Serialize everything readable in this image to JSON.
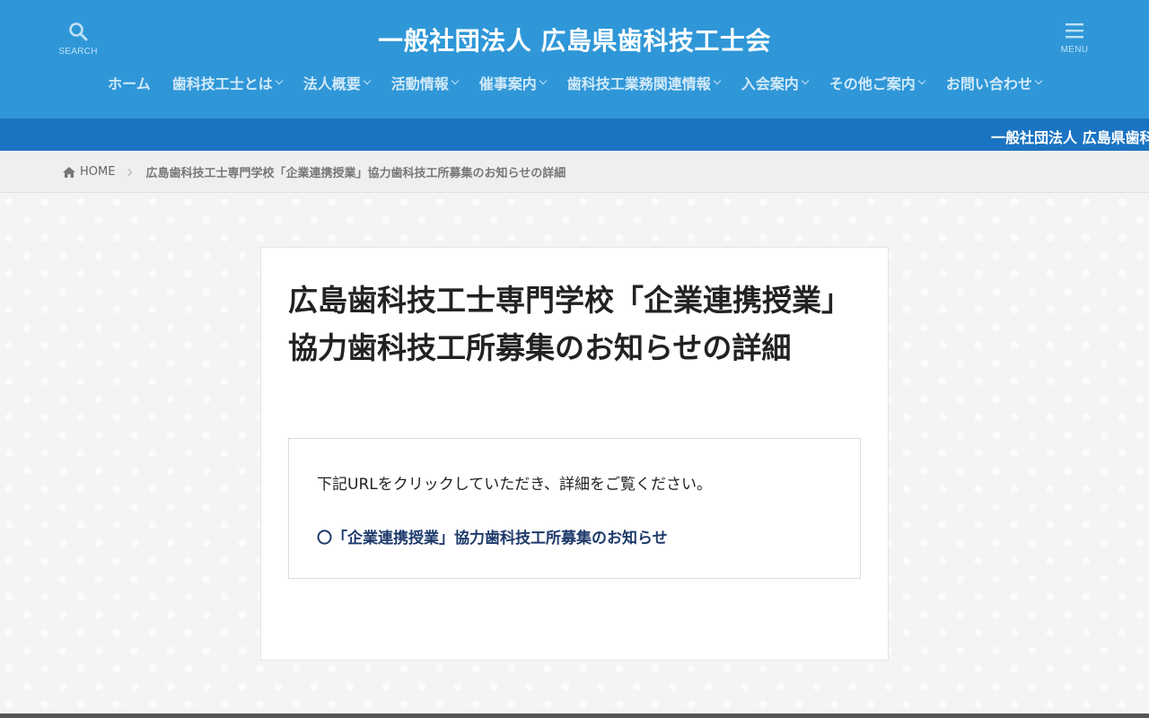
{
  "header": {
    "site_title": "一般社団法人 広島県歯科技工士会",
    "search_label": "SEARCH",
    "menu_label": "MENU",
    "brand_color": "#2f97d8"
  },
  "nav": [
    {
      "label": "ホーム",
      "has_dropdown": false
    },
    {
      "label": "歯科技工士とは",
      "has_dropdown": true
    },
    {
      "label": "法人概要",
      "has_dropdown": true
    },
    {
      "label": "活動情報",
      "has_dropdown": true
    },
    {
      "label": "催事案内",
      "has_dropdown": true
    },
    {
      "label": "歯科技工業務関連情報",
      "has_dropdown": true
    },
    {
      "label": "入会案内",
      "has_dropdown": true
    },
    {
      "label": "その他ご案内",
      "has_dropdown": true
    },
    {
      "label": "お問い合わせ",
      "has_dropdown": true
    }
  ],
  "ticker": {
    "text": "一般社団法人 広島県歯科"
  },
  "breadcrumb": {
    "home_label": "HOME",
    "current": "広島歯科技工士専門学校「企業連携授業」協力歯科技工所募集のお知らせの詳細"
  },
  "article": {
    "title": "広島歯科技工士専門学校「企業連携授業」協力歯科技工所募集のお知らせの詳細",
    "description": "下記URLをクリックしていただき、詳細をご覧ください。",
    "link_text": "〇「企業連携授業」協力歯科技工所募集のお知らせ",
    "link_color": "#1e3a6b"
  },
  "icons": {
    "search": "search-icon",
    "menu": "hamburger-menu-icon",
    "home": "home-icon"
  }
}
